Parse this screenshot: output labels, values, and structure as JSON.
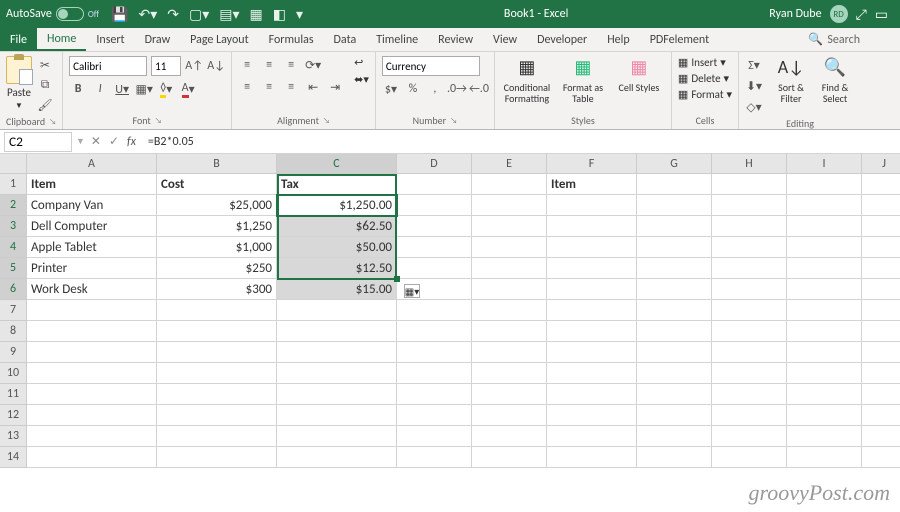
{
  "titlebar": {
    "autosave_label": "AutoSave",
    "autosave_state": "Off",
    "title": "Book1  -  Excel",
    "user_name": "Ryan Dube",
    "user_initials": "RD"
  },
  "tabs": {
    "file": "File",
    "items": [
      "Home",
      "Insert",
      "Draw",
      "Page Layout",
      "Formulas",
      "Data",
      "Timeline",
      "Review",
      "View",
      "Developer",
      "Help",
      "PDFelement"
    ],
    "active": "Home",
    "search": "Search"
  },
  "ribbon": {
    "clipboard": {
      "paste": "Paste",
      "label": "Clipboard"
    },
    "font": {
      "name": "Calibri",
      "size": "11",
      "label": "Font"
    },
    "alignment": {
      "label": "Alignment"
    },
    "number": {
      "format": "Currency",
      "label": "Number"
    },
    "styles": {
      "conditional": "Conditional Formatting",
      "table": "Format as Table",
      "cellstyles": "Cell Styles",
      "label": "Styles"
    },
    "cells": {
      "insert": "Insert",
      "delete": "Delete",
      "format": "Format",
      "label": "Cells"
    },
    "editing": {
      "sort": "Sort & Filter",
      "find": "Find & Select",
      "label": "Editing"
    }
  },
  "formula_bar": {
    "name_box": "C2",
    "formula": "=B2*0.05"
  },
  "sheet": {
    "columns": [
      "A",
      "B",
      "C",
      "D",
      "E",
      "F",
      "G",
      "H",
      "I",
      "J"
    ],
    "rows": [
      "1",
      "2",
      "3",
      "4",
      "5",
      "6",
      "7",
      "8",
      "9",
      "10",
      "11",
      "12",
      "13",
      "14"
    ],
    "headers": {
      "A1": "Item",
      "B1": "Cost",
      "C1": "Tax",
      "F1": "Item"
    },
    "data": [
      {
        "item": "Company Van",
        "cost": "$25,000",
        "tax": "$1,250.00"
      },
      {
        "item": "Dell Computer",
        "cost": "$1,250",
        "tax": "$62.50"
      },
      {
        "item": "Apple Tablet",
        "cost": "$1,000",
        "tax": "$50.00"
      },
      {
        "item": "Printer",
        "cost": "$250",
        "tax": "$12.50"
      },
      {
        "item": "Work Desk",
        "cost": "$300",
        "tax": "$15.00"
      }
    ],
    "selection": {
      "active": "C2",
      "range": "C2:C6",
      "selected_col": "C"
    }
  },
  "watermark": "groovyPost.com"
}
